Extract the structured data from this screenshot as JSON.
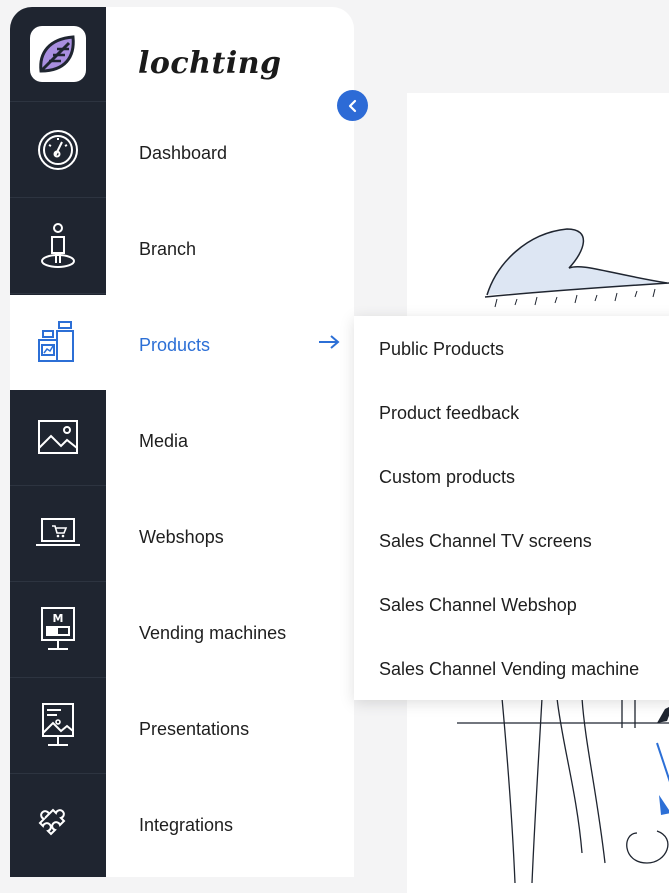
{
  "app": {
    "brand_name": "lochting",
    "colors": {
      "accent": "#2c6fd6",
      "rail_bg": "#1f2530",
      "page_bg": "#f4f4f5",
      "logo_leaf": "#a98fe0"
    }
  },
  "rail": {
    "icons": [
      "logo-leaf-icon",
      "dashboard-gauge-icon",
      "branch-person-icon",
      "products-bottles-icon",
      "media-picture-icon",
      "webshop-laptop-cart-icon",
      "vending-machine-icon",
      "presentation-easel-icon",
      "integrations-puzzle-icon"
    ],
    "active": "products-bottles-icon"
  },
  "nav": {
    "items": [
      {
        "label": "Dashboard"
      },
      {
        "label": "Branch"
      },
      {
        "label": "Products"
      },
      {
        "label": "Media"
      },
      {
        "label": "Webshops"
      },
      {
        "label": "Vending machines"
      },
      {
        "label": "Presentations"
      },
      {
        "label": "Integrations"
      }
    ],
    "active_label": "Products",
    "collapse_icon": "chevron-left-icon",
    "active_indicator_icon": "arrow-right-icon"
  },
  "submenu": {
    "items": [
      {
        "label": "Public Products"
      },
      {
        "label": "Product feedback"
      },
      {
        "label": "Custom products"
      },
      {
        "label": "Sales Channel TV screens"
      },
      {
        "label": "Sales Channel Webshop"
      },
      {
        "label": "Sales Channel Vending machine"
      }
    ]
  }
}
